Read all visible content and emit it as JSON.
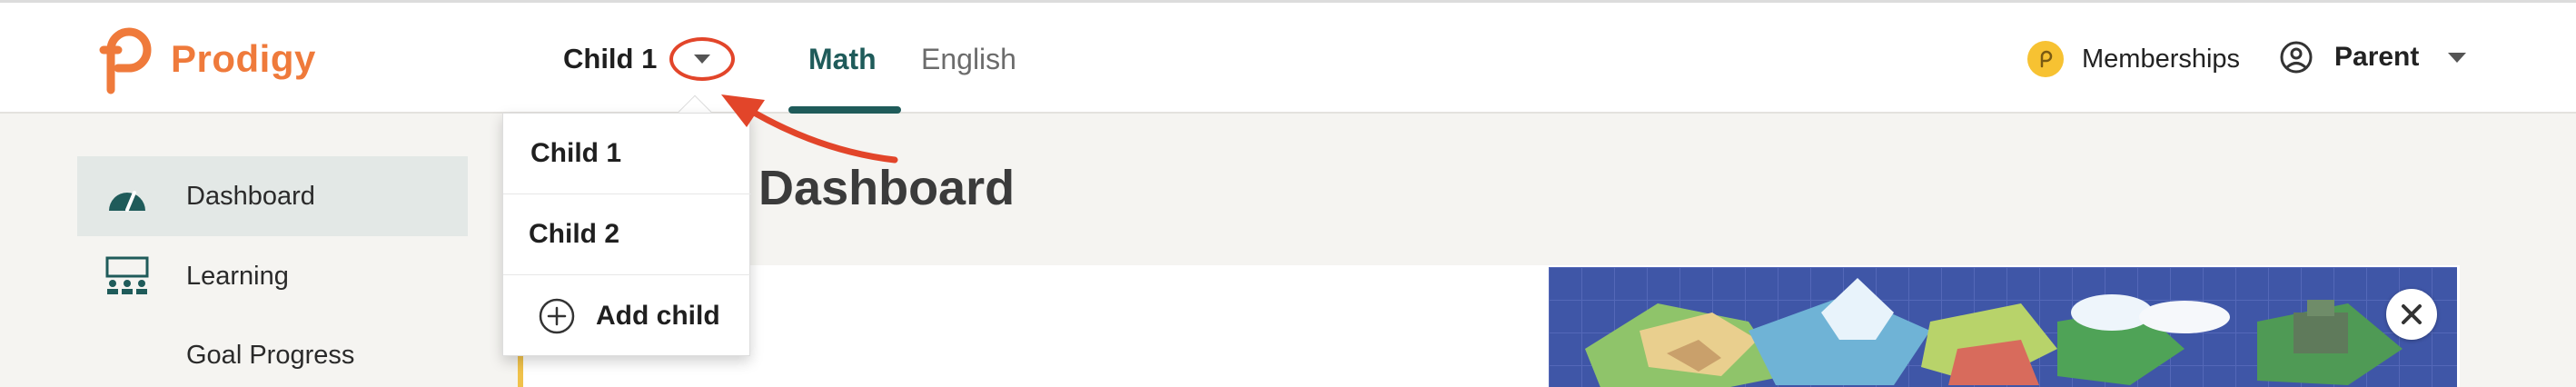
{
  "brand": {
    "name": "Prodigy",
    "color": "#ef7a3b"
  },
  "header": {
    "child_selector": {
      "label": "Child 1"
    },
    "tabs": [
      {
        "label": "Math",
        "active": true
      },
      {
        "label": "English",
        "active": false
      }
    ],
    "memberships_label": "Memberships",
    "account_label": "Parent"
  },
  "dropdown": {
    "items": [
      {
        "label": "Child 1"
      },
      {
        "label": "Child 2"
      }
    ],
    "add_label": "Add child"
  },
  "sidebar": {
    "items": [
      {
        "label": "Dashboard",
        "icon": "speedometer-icon",
        "active": true
      },
      {
        "label": "Learning",
        "icon": "classroom-icon",
        "active": false
      },
      {
        "label": "Goal Progress",
        "icon": "",
        "active": false
      }
    ]
  },
  "main": {
    "title_visible": "s Dashboard",
    "card_hint_visible": ","
  },
  "colors": {
    "accent_teal": "#1f5b5a",
    "annotation_red": "#e2452a",
    "coin_yellow": "#f7c232"
  }
}
